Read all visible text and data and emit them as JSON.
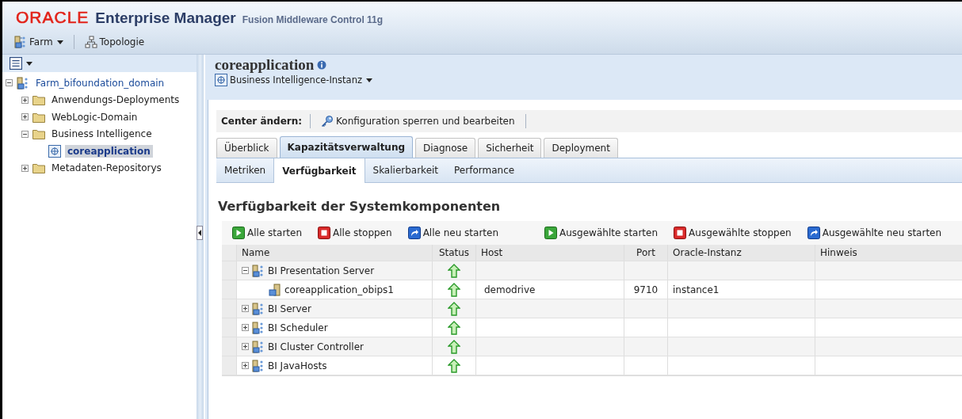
{
  "header": {
    "logo": "ORACLE",
    "product": "Enterprise Manager",
    "subtitle": "Fusion Middleware Control 11g"
  },
  "toolbar": [
    {
      "label": "Farm",
      "kind": "farm",
      "dropdown": true
    },
    {
      "label": "Topologie",
      "kind": "topology",
      "dropdown": false
    }
  ],
  "navigator": {
    "tree": [
      {
        "label": "Farm_bifoundation_domain",
        "kind": "farm",
        "expanded": true,
        "selected": false,
        "children": [
          {
            "label": "Anwendungs-Deployments",
            "kind": "folder",
            "expanded": false,
            "selected": false
          },
          {
            "label": "WebLogic-Domain",
            "kind": "folder",
            "expanded": false,
            "selected": false
          },
          {
            "label": "Business Intelligence",
            "kind": "folder",
            "expanded": true,
            "selected": false,
            "children": [
              {
                "label": "coreapplication",
                "kind": "instance",
                "selected": true
              }
            ]
          },
          {
            "label": "Metadaten-Repositorys",
            "kind": "folder",
            "expanded": false,
            "selected": false
          }
        ]
      }
    ]
  },
  "page": {
    "title": "coreapplication",
    "target_type": "Business Intelligence-Instanz",
    "change_center": {
      "label": "Center ändern:",
      "action": "Konfiguration sperren und bearbeiten"
    },
    "tabs": [
      {
        "label": "Überblick",
        "selected": false
      },
      {
        "label": "Kapazitätsverwaltung",
        "selected": true
      },
      {
        "label": "Diagnose",
        "selected": false
      },
      {
        "label": "Sicherheit",
        "selected": false
      },
      {
        "label": "Deployment",
        "selected": false
      }
    ],
    "subtabs": [
      {
        "label": "Metriken",
        "selected": false
      },
      {
        "label": "Verfügbarkeit",
        "selected": true
      },
      {
        "label": "Skalierbarkeit",
        "selected": false
      },
      {
        "label": "Performance",
        "selected": false
      }
    ],
    "section_title": "Verfügbarkeit der Systemkomponenten",
    "actions": [
      {
        "label": "Alle starten",
        "kind": "start"
      },
      {
        "label": "Alle stoppen",
        "kind": "stop"
      },
      {
        "label": "Alle neu starten",
        "kind": "restart"
      },
      {
        "label": "Ausgewählte starten",
        "kind": "start"
      },
      {
        "label": "Ausgewählte stoppen",
        "kind": "stop"
      },
      {
        "label": "Ausgewählte neu starten",
        "kind": "restart"
      }
    ],
    "table": {
      "columns": [
        "Name",
        "Status",
        "Host",
        "Port",
        "Oracle-Instanz",
        "Hinweis"
      ],
      "rows": [
        {
          "name": "BI Presentation Server",
          "kind": "group",
          "running": true,
          "expanded": true,
          "children": [
            {
              "name": "coreapplication_obips1",
              "kind": "process",
              "running": true,
              "host": "demodrive",
              "port": "9710",
              "instance": "instance1"
            }
          ]
        },
        {
          "name": "BI Server",
          "kind": "group",
          "running": true,
          "expanded": false
        },
        {
          "name": "BI Scheduler",
          "kind": "group",
          "running": true,
          "expanded": false
        },
        {
          "name": "BI Cluster Controller",
          "kind": "group",
          "running": true,
          "expanded": false
        },
        {
          "name": "BI JavaHosts",
          "kind": "group",
          "running": true,
          "expanded": false
        }
      ]
    }
  }
}
